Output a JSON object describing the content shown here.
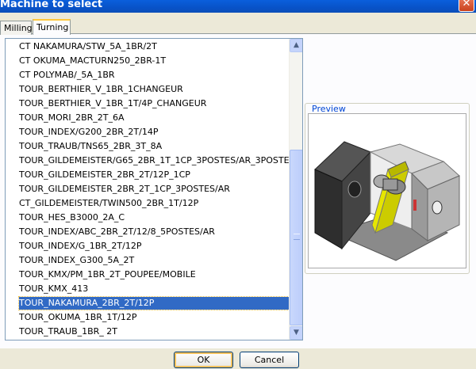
{
  "window": {
    "title": "Machine to select",
    "close_glyph": "✕"
  },
  "tabs": [
    {
      "label": "Milling",
      "active": false
    },
    {
      "label": "Turning",
      "active": true
    }
  ],
  "machine_list": {
    "items": [
      "CT NAKAMURA/STW_5A_1BR/2T",
      "CT OKUMA_MACTURN250_2BR-1T",
      "CT POLYMAB/_5A_1BR",
      "TOUR_BERTHIER_V_1BR_1CHANGEUR",
      "TOUR_BERTHIER_V_1BR_1T/4P_CHANGEUR",
      "TOUR_MORI_2BR_2T_6A",
      "TOUR_INDEX/G200_2BR_2T/14P",
      "TOUR_TRAUB/TNS65_2BR_3T_8A",
      "TOUR_GILDEMEISTER/G65_2BR_1T_1CP_3POSTES/AR_3POSTE",
      "TOUR_GILDEMEISTER_2BR_2T/12P_1CP",
      "TOUR_GILDEMEISTER_2BR_2T_1CP_3POSTES/AR",
      "CT_GILDEMEISTER/TWIN500_2BR_1T/12P",
      "TOUR_HES_B3000_2A_C",
      "TOUR_INDEX/ABC_2BR_2T/12/8_5POSTES/AR",
      "TOUR_INDEX/G_1BR_2T/12P",
      "TOUR_INDEX_G300_5A_2T",
      "TOUR_KMX/PM_1BR_2T_POUPEE/MOBILE",
      "TOUR_KMX_413",
      "TOUR_NAKAMURA_2BR_2T/12P",
      "TOUR_OKUMA_1BR_1T/12P",
      "TOUR_TRAUB_1BR_ 2T"
    ],
    "selected": "TOUR_NAKAMURA_2BR_2T/12P"
  },
  "preview": {
    "label": "Preview",
    "image_icon": "machine-3d-model"
  },
  "buttons": {
    "ok": "OK",
    "cancel": "Cancel"
  },
  "colors": {
    "selection": "#316ac5",
    "title_bar": "#0a5fdc",
    "preview_label": "#0046d5"
  }
}
